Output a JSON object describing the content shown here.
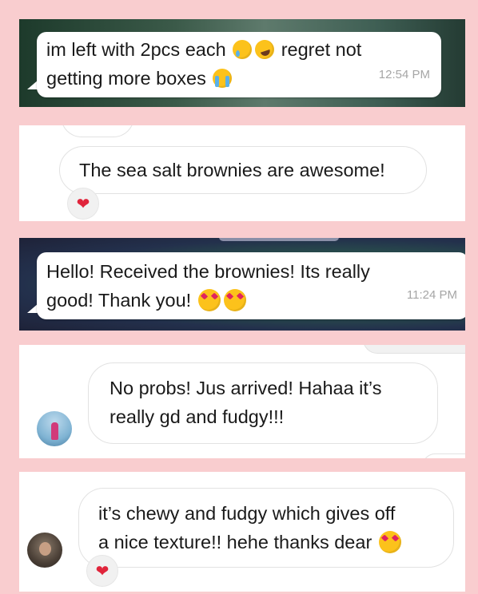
{
  "messages": [
    {
      "line1": "im left with 2pcs each",
      "line1_end": "regret not",
      "line2": "getting more boxes",
      "time": "12:54 PM"
    },
    {
      "text": "The sea salt brownies are awesome!",
      "reaction": "❤"
    },
    {
      "line1": "Hello! Received the brownies! Its really",
      "line2": "good! Thank you!",
      "time": "11:24 PM"
    },
    {
      "line1": "No probs! Jus arrived! Hahaa it’s",
      "line2": "really gd and fudgy!!!"
    },
    {
      "line1": "it’s chewy and fudgy which gives off",
      "line2": "a nice texture!! hehe thanks dear",
      "reaction": "❤"
    }
  ],
  "emoji_names": [
    "crying-face",
    "rolling-on-floor-laughing",
    "loudly-crying-face",
    "heart-eyes",
    "smiling-face-with-hearts"
  ],
  "colors": {
    "background": "#f9cdcf",
    "heart": "#e0243b",
    "timestamp": "#a6a6a6"
  }
}
